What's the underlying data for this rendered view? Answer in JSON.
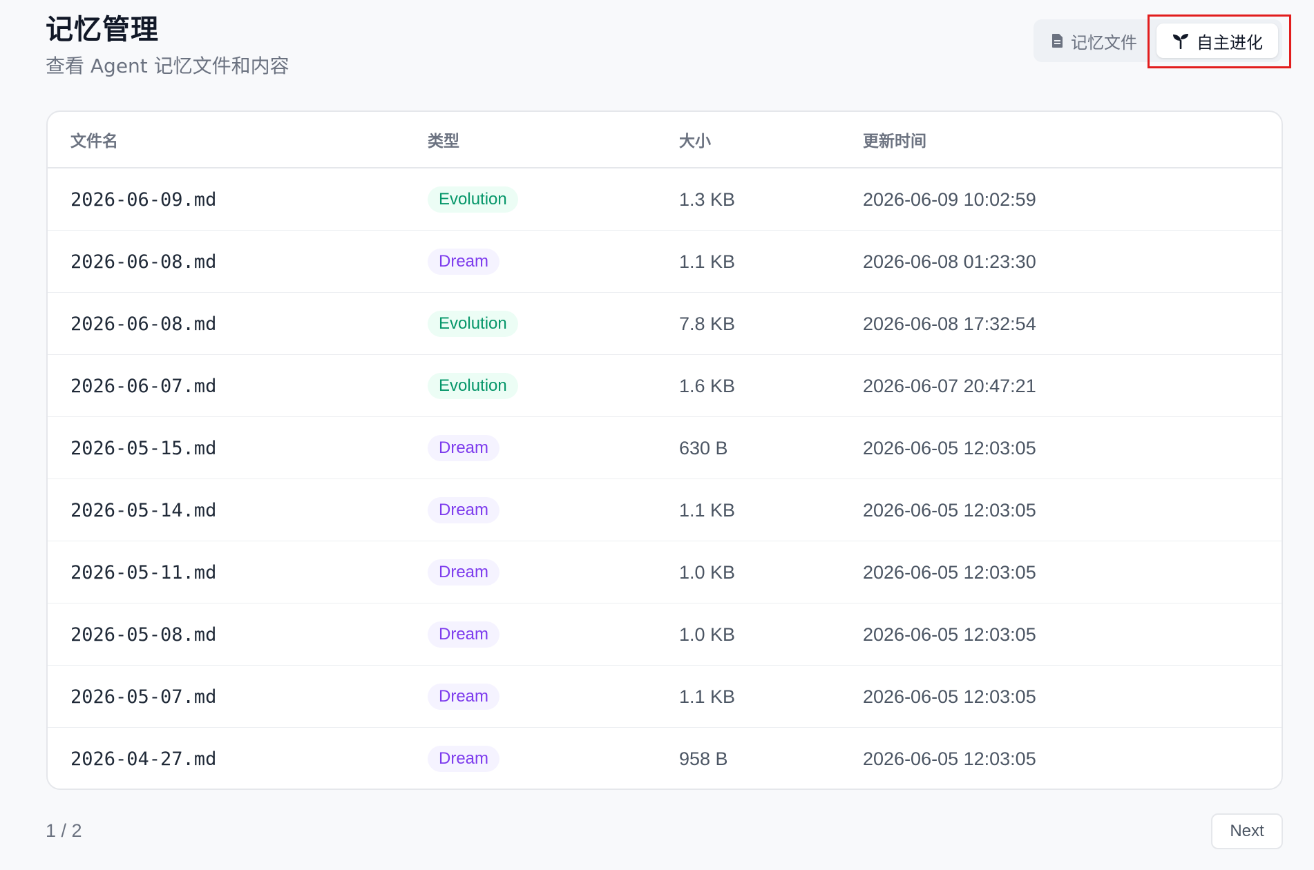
{
  "header": {
    "title": "记忆管理",
    "subtitle": "查看 Agent 记忆文件和内容"
  },
  "tabs": {
    "files_label": "记忆文件",
    "evolution_label": "自主进化",
    "active": "evolution"
  },
  "table": {
    "columns": [
      "文件名",
      "类型",
      "大小",
      "更新时间"
    ],
    "rows": [
      {
        "name": "2026-06-09.md",
        "type": "Evolution",
        "size": "1.3 KB",
        "updated": "2026-06-09 10:02:59"
      },
      {
        "name": "2026-06-08.md",
        "type": "Dream",
        "size": "1.1 KB",
        "updated": "2026-06-08 01:23:30"
      },
      {
        "name": "2026-06-08.md",
        "type": "Evolution",
        "size": "7.8 KB",
        "updated": "2026-06-08 17:32:54"
      },
      {
        "name": "2026-06-07.md",
        "type": "Evolution",
        "size": "1.6 KB",
        "updated": "2026-06-07 20:47:21"
      },
      {
        "name": "2026-05-15.md",
        "type": "Dream",
        "size": "630 B",
        "updated": "2026-06-05 12:03:05"
      },
      {
        "name": "2026-05-14.md",
        "type": "Dream",
        "size": "1.1 KB",
        "updated": "2026-06-05 12:03:05"
      },
      {
        "name": "2026-05-11.md",
        "type": "Dream",
        "size": "1.0 KB",
        "updated": "2026-06-05 12:03:05"
      },
      {
        "name": "2026-05-08.md",
        "type": "Dream",
        "size": "1.0 KB",
        "updated": "2026-06-05 12:03:05"
      },
      {
        "name": "2026-05-07.md",
        "type": "Dream",
        "size": "1.1 KB",
        "updated": "2026-06-05 12:03:05"
      },
      {
        "name": "2026-04-27.md",
        "type": "Dream",
        "size": "958 B",
        "updated": "2026-06-05 12:03:05"
      }
    ]
  },
  "pagination": {
    "page_text": "1 / 2",
    "next_label": "Next"
  },
  "colors": {
    "evolution_badge_text": "#059669",
    "evolution_badge_bg": "#ecfdf5",
    "dream_badge_text": "#7c3aed",
    "dream_badge_bg": "#f5f3ff",
    "highlight_outline": "#e21d1d"
  },
  "icons": {
    "files_tab": "document-icon",
    "evolution_tab": "sprout-icon"
  }
}
